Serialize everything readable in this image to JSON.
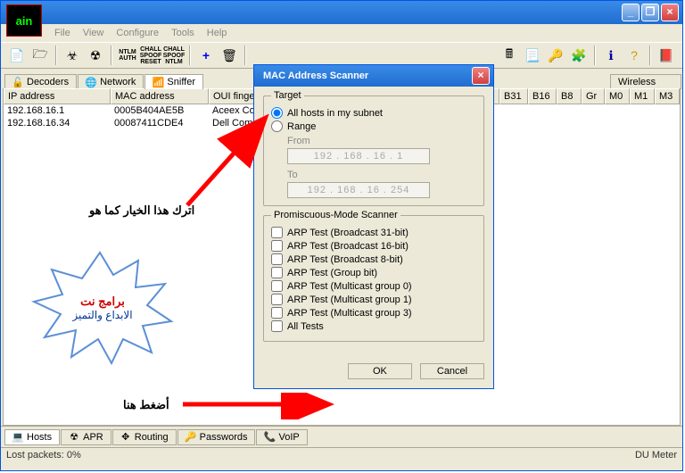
{
  "logo": "ain",
  "menu": [
    "File",
    "View",
    "Configure",
    "Tools",
    "Help"
  ],
  "tabs_top": [
    {
      "icon": "🔓",
      "label": "Decoders"
    },
    {
      "icon": "🌐",
      "label": "Network"
    },
    {
      "icon": "📶",
      "label": "Sniffer",
      "active": true
    },
    {
      "icon": "",
      "label": ""
    },
    {
      "icon": "📡",
      "label": "Wireless"
    }
  ],
  "columns_left": [
    "IP address",
    "MAC address",
    "OUI finger"
  ],
  "columns_right": [
    "B31",
    "B16",
    "B8",
    "Gr",
    "M0",
    "M1",
    "M3"
  ],
  "rows": [
    {
      "ip": "192.168.16.1",
      "mac": "0005B404AE5B",
      "oui": "Aceex Cor"
    },
    {
      "ip": "192.168.16.34",
      "mac": "00087411CDE4",
      "oui": "Dell Com"
    }
  ],
  "tabs_bottom": [
    {
      "icon": "💻",
      "label": "Hosts",
      "active": true
    },
    {
      "icon": "☢",
      "label": "APR"
    },
    {
      "icon": "✥",
      "label": "Routing"
    },
    {
      "icon": "🔑",
      "label": "Passwords"
    },
    {
      "icon": "📞",
      "label": "VoIP"
    }
  ],
  "status_left": "Lost packets:  0%",
  "status_right": "DU Meter",
  "dialog": {
    "title": "MAC Address Scanner",
    "target_label": "Target",
    "opt_all": "All hosts in my subnet",
    "opt_range": "Range",
    "from_label": "From",
    "from_val": "192 . 168 . 16 .  1",
    "to_label": "To",
    "to_val": "192 . 168 . 16 . 254",
    "promisc_label": "Promiscuous-Mode Scanner",
    "tests": [
      "ARP Test (Broadcast 31-bit)",
      "ARP Test (Broadcast 16-bit)",
      "ARP Test (Broadcast 8-bit)",
      "ARP Test (Group bit)",
      "ARP Test (Multicast group 0)",
      "ARP Test (Multicast group 1)",
      "ARP Test (Multicast group 3)",
      "All Tests"
    ],
    "ok": "OK",
    "cancel": "Cancel"
  },
  "anno1": "اترك هذا الخيار كما هو",
  "anno2": "أضغط هنا",
  "burst1": "برامج نت",
  "burst2": "الابداع والتميز"
}
